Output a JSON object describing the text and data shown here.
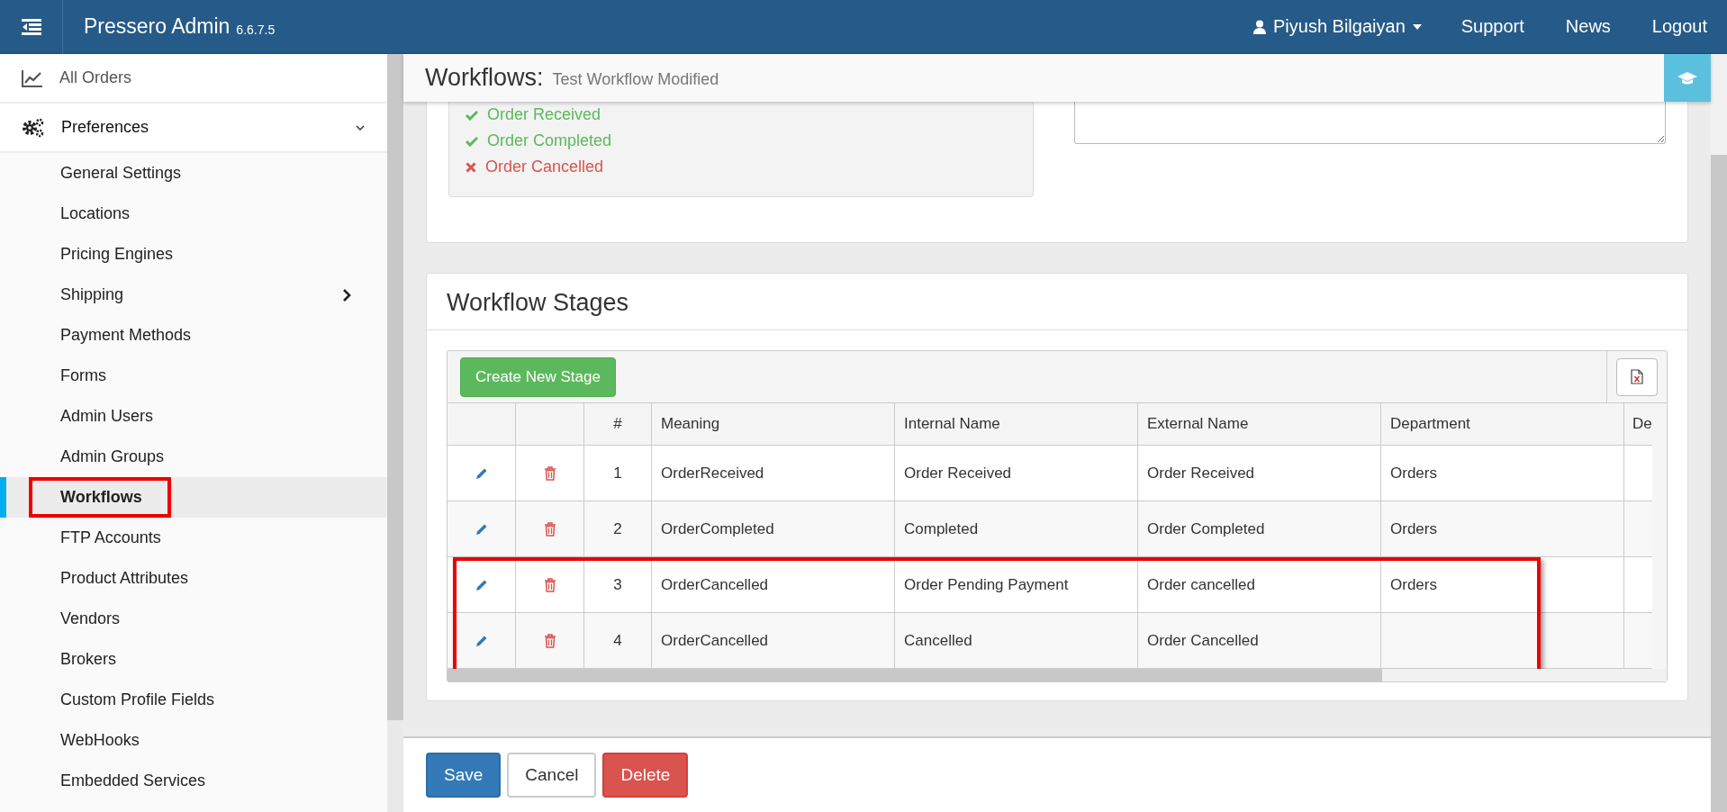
{
  "topbar": {
    "app_name": "Pressero Admin",
    "version": "6.6.7.5",
    "user": "Piyush Bilgaiyan",
    "links": [
      "Support",
      "News",
      "Logout"
    ]
  },
  "sidebar": {
    "top_items": [
      {
        "label": "All Orders",
        "kind": "chart"
      },
      {
        "label": "Preferences",
        "kind": "gears",
        "expanded": true
      }
    ],
    "items": [
      {
        "label": "General Settings",
        "selected": false,
        "annotated": false,
        "has_submenu": false
      },
      {
        "label": "Locations",
        "selected": false,
        "annotated": false,
        "has_submenu": false
      },
      {
        "label": "Pricing Engines",
        "selected": false,
        "annotated": false,
        "has_submenu": false
      },
      {
        "label": "Shipping",
        "selected": false,
        "annotated": false,
        "has_submenu": true
      },
      {
        "label": "Payment Methods",
        "selected": false,
        "annotated": false,
        "has_submenu": false
      },
      {
        "label": "Forms",
        "selected": false,
        "annotated": false,
        "has_submenu": false
      },
      {
        "label": "Admin Users",
        "selected": false,
        "annotated": false,
        "has_submenu": false
      },
      {
        "label": "Admin Groups",
        "selected": false,
        "annotated": false,
        "has_submenu": false
      },
      {
        "label": "Workflows",
        "selected": true,
        "annotated": true,
        "has_submenu": false
      },
      {
        "label": "FTP Accounts",
        "selected": false,
        "annotated": false,
        "has_submenu": false
      },
      {
        "label": "Product Attributes",
        "selected": false,
        "annotated": false,
        "has_submenu": false
      },
      {
        "label": "Vendors",
        "selected": false,
        "annotated": false,
        "has_submenu": false
      },
      {
        "label": "Brokers",
        "selected": false,
        "annotated": false,
        "has_submenu": false
      },
      {
        "label": "Custom Profile Fields",
        "selected": false,
        "annotated": false,
        "has_submenu": false
      },
      {
        "label": "WebHooks",
        "selected": false,
        "annotated": false,
        "has_submenu": false
      },
      {
        "label": "Embedded Services",
        "selected": false,
        "annotated": false,
        "has_submenu": false
      }
    ]
  },
  "page_header": {
    "title": "Workflows:",
    "subtitle": "Test Workflow Modified"
  },
  "statuses": [
    {
      "label": "Order Received",
      "kind": "success"
    },
    {
      "label": "Order Completed",
      "kind": "success"
    },
    {
      "label": "Order Cancelled",
      "kind": "failure"
    }
  ],
  "stages_panel": {
    "title": "Workflow Stages",
    "create_button": "Create New Stage",
    "columns": [
      "#",
      "Meaning",
      "Internal Name",
      "External Name",
      "Department",
      "De"
    ],
    "rows": [
      {
        "number": "1",
        "meaning": "OrderReceived",
        "internal_name": "Order Received",
        "external_name": "Order Received",
        "department": "Orders",
        "annotated": false
      },
      {
        "number": "2",
        "meaning": "OrderCompleted",
        "internal_name": "Completed",
        "external_name": "Order Completed",
        "department": "Orders",
        "annotated": false
      },
      {
        "number": "3",
        "meaning": "OrderCancelled",
        "internal_name": "Order Pending Payment",
        "external_name": "Order cancelled",
        "department": "Orders",
        "annotated": true
      },
      {
        "number": "4",
        "meaning": "OrderCancelled",
        "internal_name": "Cancelled",
        "external_name": "Order Cancelled",
        "annotated": true
      }
    ]
  },
  "buttons": [
    {
      "label": "Save",
      "kind": "primary"
    },
    {
      "label": "Cancel",
      "kind": "default"
    },
    {
      "label": "Delete",
      "kind": "danger"
    }
  ]
}
